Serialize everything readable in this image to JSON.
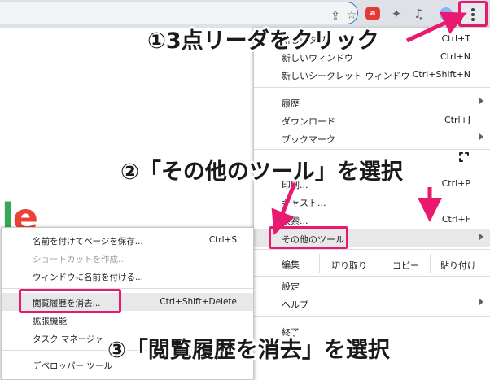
{
  "toolbar": {
    "icons": [
      "share-icon",
      "star-icon",
      "extension-red-icon",
      "puzzle-icon",
      "reading-list-icon",
      "profile-icon",
      "more-menu-icon"
    ],
    "ext_badge": "a",
    "accent": "#e8196f"
  },
  "menu": {
    "items": [
      {
        "label": "新しいタブ",
        "shortcut": "Ctrl+T"
      },
      {
        "label": "新しいウィンドウ",
        "shortcut": "Ctrl+N"
      },
      {
        "label": "新しいシークレット ウィンドウ",
        "shortcut": "Ctrl+Shift+N"
      },
      {
        "label": "履歴",
        "shortcut": ""
      },
      {
        "label": "ダウンロード",
        "shortcut": "Ctrl+J"
      },
      {
        "label": "ブックマーク",
        "shortcut": ""
      },
      {
        "label": "印刷...",
        "shortcut": "Ctrl+P"
      },
      {
        "label": "キャスト...",
        "shortcut": ""
      },
      {
        "label": "検索...",
        "shortcut": "Ctrl+F"
      },
      {
        "label": "その他のツール",
        "shortcut": ""
      },
      {
        "label": "設定",
        "shortcut": ""
      },
      {
        "label": "ヘルプ",
        "shortcut": ""
      },
      {
        "label": "終了",
        "shortcut": ""
      }
    ],
    "edit": {
      "label": "編集",
      "cut": "切り取り",
      "copy": "コピー",
      "paste": "貼り付け"
    }
  },
  "submenu": {
    "items": [
      {
        "label": "名前を付けてページを保存...",
        "shortcut": "Ctrl+S",
        "disabled": false
      },
      {
        "label": "ショートカットを作成...",
        "shortcut": "",
        "disabled": true
      },
      {
        "label": "ウィンドウに名前を付ける...",
        "shortcut": "",
        "disabled": false
      },
      {
        "label": "閲覧履歴を消去...",
        "shortcut": "Ctrl+Shift+Delete",
        "disabled": false
      },
      {
        "label": "拡張機能",
        "shortcut": "",
        "disabled": false
      },
      {
        "label": "タスク マネージャ",
        "shortcut": "",
        "disabled": false
      },
      {
        "label": "デベロッパー ツール",
        "shortcut": "",
        "disabled": false
      }
    ]
  },
  "annotations": {
    "step1": "①3点リーダをクリック",
    "step2": "②「その他のツール」を選択",
    "step3": "③「閲覧履歴を消去」を選択"
  },
  "page": {
    "logo_fragment": "le"
  }
}
